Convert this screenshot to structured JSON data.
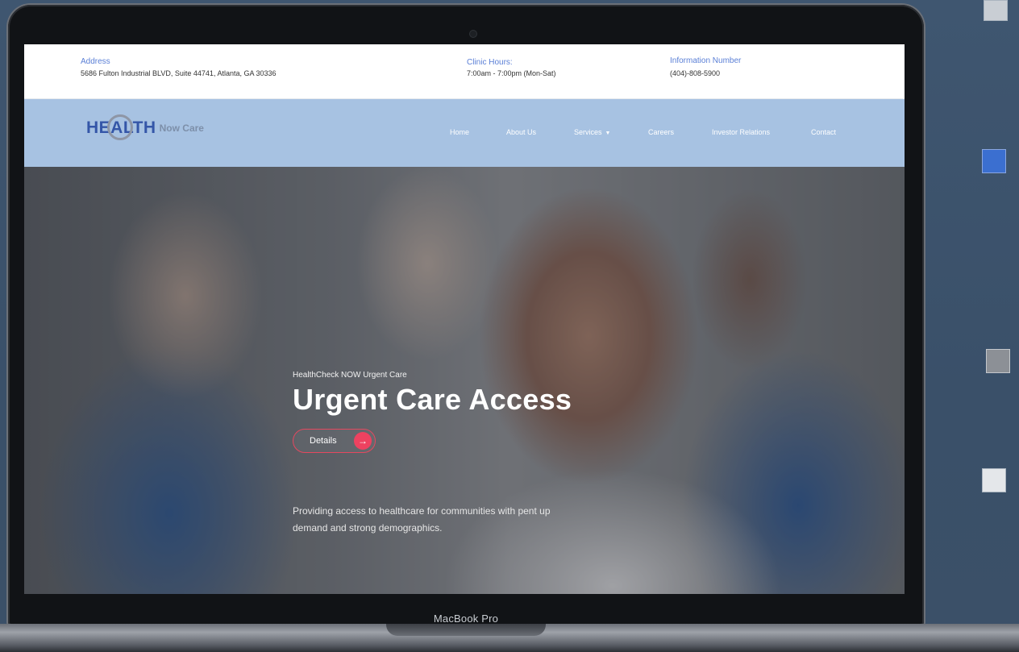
{
  "device": {
    "label": "MacBook Pro"
  },
  "topbar": {
    "address_label": "Address",
    "address_value": "5686 Fulton Industrial BLVD, Suite 44741, Atlanta, GA 30336",
    "hours_label": "Clinic Hours:",
    "hours_value": "7:00am - 7:00pm (Mon-Sat)",
    "phone_label": "Information Number",
    "phone_value": "(404)-808-5900"
  },
  "logo": {
    "main": "HEALTH",
    "sub": "Now Care"
  },
  "nav": {
    "items": [
      "Home",
      "About Us",
      "Services",
      "Careers",
      "Investor Relations",
      "Contact"
    ]
  },
  "hero": {
    "eyebrow": "HealthCheck NOW Urgent Care",
    "title": "Urgent Care Access",
    "button_label": "Details",
    "button_icon": "arrow-right-icon",
    "description": "Providing access to healthcare for communities with pent up demand and strong demographics."
  },
  "colors": {
    "accent": "#ee4260",
    "nav_bg": "#a7c2e2",
    "link_blue": "#5a7fd6",
    "logo_blue": "#3456a8"
  }
}
